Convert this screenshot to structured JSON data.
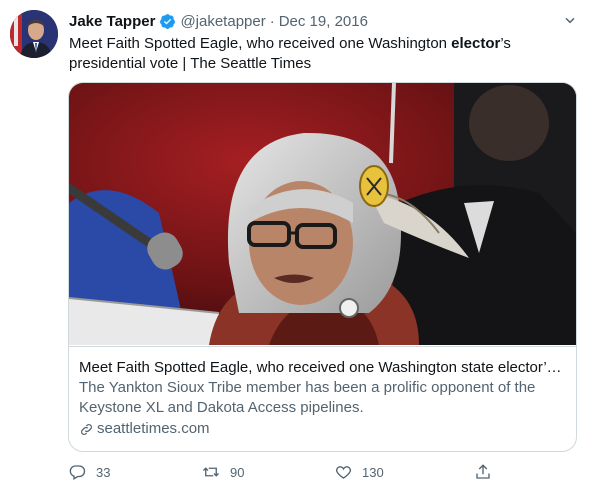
{
  "tweet": {
    "author_name": "Jake Tapper",
    "handle": "@jaketapper",
    "separator": "·",
    "date": "Dec 19, 2016",
    "text_before": "Meet Faith Spotted Eagle, who received one Washington ",
    "text_highlight": "elector",
    "text_after": "’s presidential vote | The Seattle Times"
  },
  "card": {
    "title": "Meet Faith Spotted Eagle, who received one Washington state elector’s ...",
    "description": "The Yankton Sioux Tribe member has been a prolific opponent of the Keystone XL and Dakota Access pipelines.",
    "domain": "seattletimes.com"
  },
  "actions": {
    "replies": "33",
    "retweets": "90",
    "likes": "130"
  },
  "icons": {
    "verified": "verified-badge-icon",
    "more": "more-options-icon",
    "link": "link-icon",
    "reply": "reply-icon",
    "retweet": "retweet-icon",
    "like": "heart-icon",
    "share": "share-icon"
  },
  "colors": {
    "verified": "#1d9bf0",
    "secondary_text": "#536471",
    "border": "#cfd9de"
  }
}
